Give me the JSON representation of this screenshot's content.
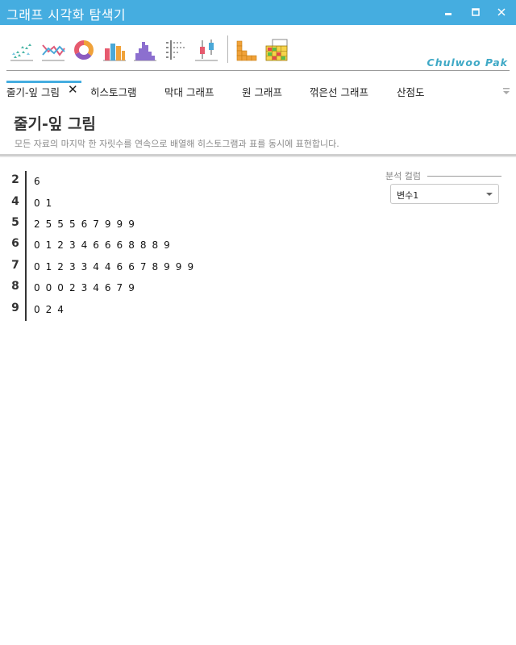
{
  "window": {
    "title": "그래프 시각화 탐색기",
    "buttons": [
      "minimize",
      "maximize",
      "close"
    ]
  },
  "toolbar": {
    "icons": [
      "scatter-chart-icon",
      "line-chart-icon",
      "donut-chart-icon",
      "bar-chart-icon",
      "histogram-icon",
      "stem-leaf-icon",
      "box-plot-icon",
      "stacked-bar-icon",
      "grid-table-icon"
    ],
    "brand": "Chulwoo Pak"
  },
  "tabs": [
    {
      "label": "줄기-잎 그림",
      "active": true,
      "closable": true
    },
    {
      "label": "히스토그램"
    },
    {
      "label": "막대 그래프"
    },
    {
      "label": "원 그래프"
    },
    {
      "label": "꺾은선 그래프"
    },
    {
      "label": "산점도"
    }
  ],
  "header": {
    "title": "줄기-잎 그림",
    "description": "모든 자료의 마지막 한 자릿수를 연속으로 배열해 히스토그램과 표를 동시에 표현합니다."
  },
  "stem_leaf": {
    "rows": [
      {
        "stem": "2",
        "leaves": "6"
      },
      {
        "stem": "4",
        "leaves": "0 1"
      },
      {
        "stem": "5",
        "leaves": "2 5 5 5 6 7 9 9 9"
      },
      {
        "stem": "6",
        "leaves": "0 1 2 3 4 6 6 6 8 8 8 9"
      },
      {
        "stem": "7",
        "leaves": "0 1 2 3 3 4 4 6 6 7 8 9 9 9"
      },
      {
        "stem": "8",
        "leaves": "0 0 0 2 3 4 6 7 9"
      },
      {
        "stem": "9",
        "leaves": "0 2 4"
      }
    ]
  },
  "analysis": {
    "label": "분석 컬럼",
    "selected": "변수1"
  },
  "colors": {
    "accent": "#45ade0",
    "brand": "#3fa9c6"
  }
}
